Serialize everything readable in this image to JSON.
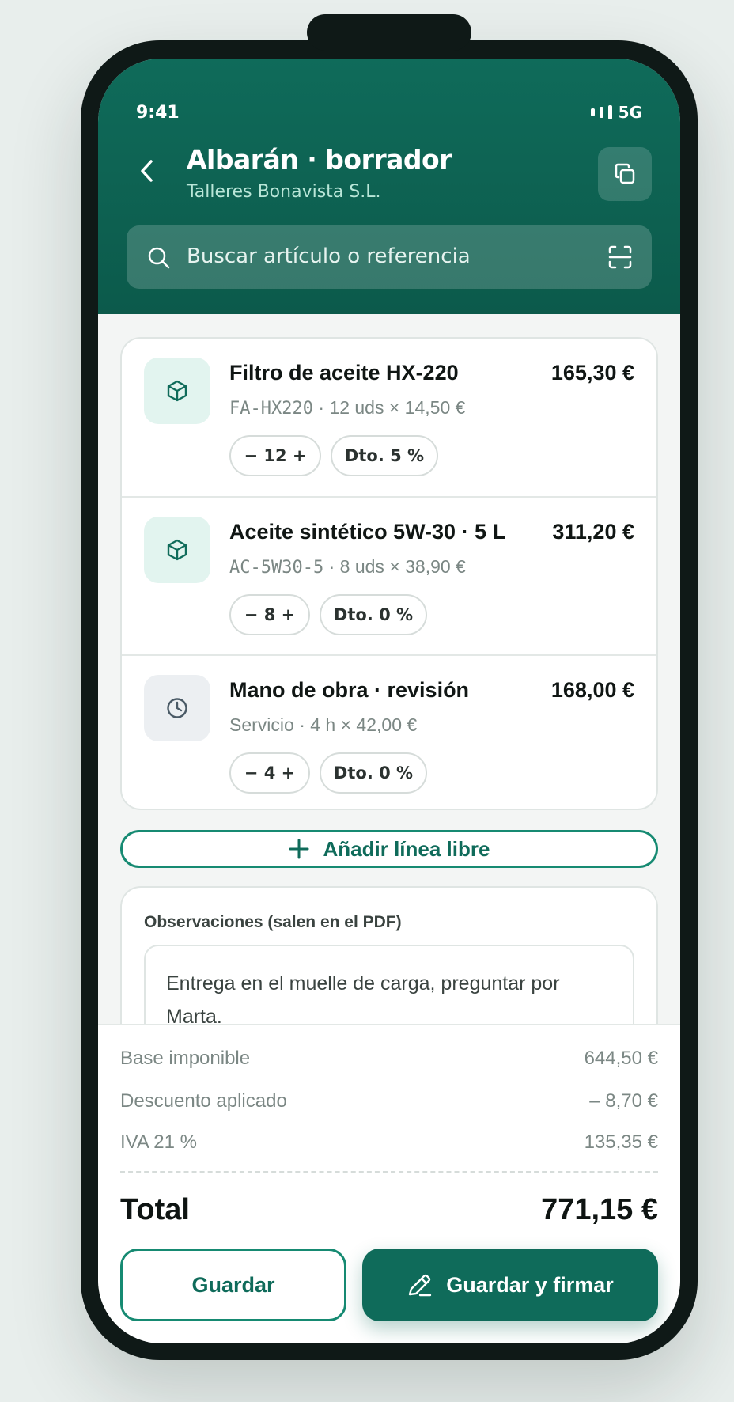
{
  "status_bar": {
    "time": "9:41",
    "network": "5G"
  },
  "header": {
    "title": "Albarán · borrador",
    "subtitle": "Talleres Bonavista S.L.",
    "back_icon": "chevron-left-icon",
    "copy_icon": "copy-icon"
  },
  "search": {
    "placeholder": "Buscar artículo o referencia",
    "icon": "search-icon",
    "scan_icon": "scan-icon"
  },
  "items": [
    {
      "icon": "box-icon",
      "name": "Filtro de aceite HX-220",
      "price": "165,30 €",
      "ref": "FA-HX220",
      "detail": " · 12 uds × 14,50 €",
      "qty": "− 12 +",
      "discount": "Dto. 5 %"
    },
    {
      "icon": "box-icon",
      "name": "Aceite sintético 5W-30 · 5 L",
      "price": "311,20 €",
      "ref": "AC-5W30-5",
      "detail": " · 8 uds × 38,90 €",
      "qty": "− 8 +",
      "discount": "Dto. 0 %"
    },
    {
      "icon": "clock-icon",
      "name": "Mano de obra · revisión",
      "price": "168,00 €",
      "ref": "",
      "detail": "Servicio · 4 h × 42,00 €",
      "qty": "− 4 +",
      "discount": "Dto. 0 %"
    }
  ],
  "add_line_label": "Añadir línea libre",
  "notes": {
    "label": "Observaciones (salen en el PDF)",
    "text": "Entrega en el muelle de carga, preguntar por Marta."
  },
  "totals": {
    "base_label": "Base imponible",
    "base_value": "644,50 €",
    "discount_label": "Descuento aplicado",
    "discount_value": "– 8,70 €",
    "iva_label": "IVA 21 %",
    "iva_value": "135,35 €",
    "total_label": "Total",
    "total_value": "771,15 €"
  },
  "actions": {
    "save": "Guardar",
    "save_sign": "Guardar y firmar",
    "sign_icon": "pen-icon"
  },
  "colors": {
    "brand": "#0f6b5a",
    "accent": "#168a72"
  }
}
